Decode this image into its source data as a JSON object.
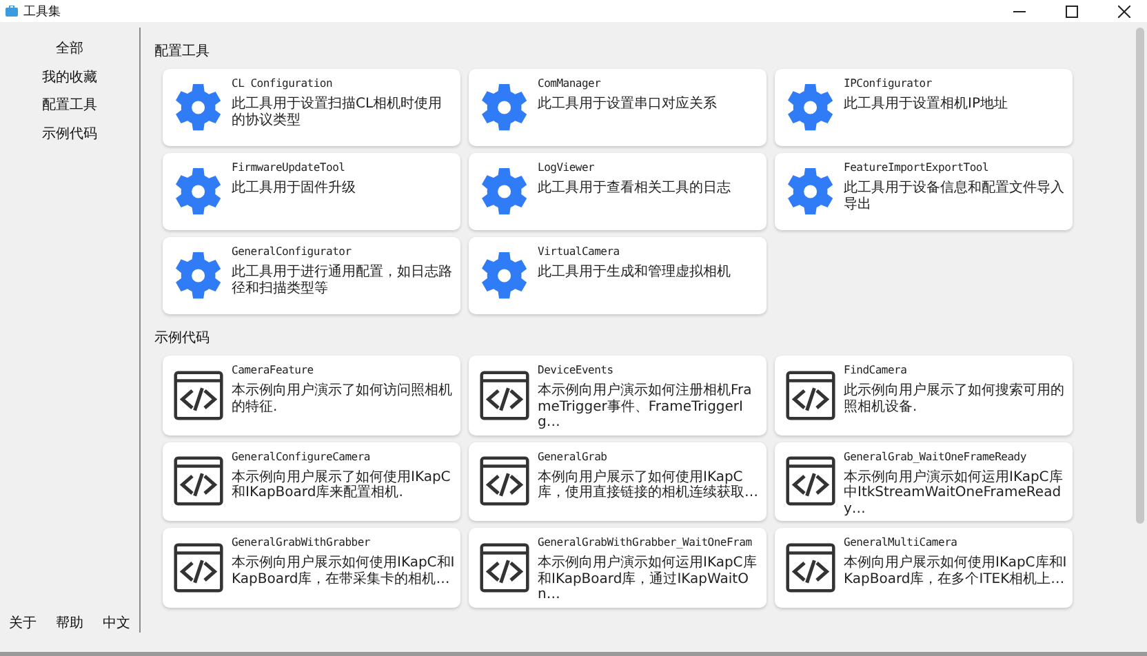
{
  "window": {
    "title": "工具集"
  },
  "sidebar": {
    "items": [
      {
        "label": "全部",
        "selected": false
      },
      {
        "label": "我的收藏",
        "selected": false
      },
      {
        "label": "配置工具",
        "selected": false
      },
      {
        "label": "示例代码",
        "selected": false
      }
    ],
    "footer": [
      "关于",
      "帮助",
      "中文"
    ]
  },
  "sections": [
    {
      "title": "配置工具",
      "kind": "tool",
      "cards": [
        {
          "name": "CL Configuration",
          "description": "此工具用于设置扫描CL相机时使用的协议类型"
        },
        {
          "name": "ComManager",
          "description": "此工具用于设置串口对应关系"
        },
        {
          "name": "IPConfigurator",
          "description": "此工具用于设置相机IP地址"
        },
        {
          "name": "FirmwareUpdateTool",
          "description": "此工具用于固件升级"
        },
        {
          "name": "LogViewer",
          "description": "此工具用于查看相关工具的日志"
        },
        {
          "name": "FeatureImportExportTool",
          "description": "此工具用于设备信息和配置文件导入导出"
        },
        {
          "name": "GeneralConfigurator",
          "description": "此工具用于进行通用配置，如日志路径和扫描类型等"
        },
        {
          "name": "VirtualCamera",
          "description": "此工具用于生成和管理虚拟相机"
        }
      ]
    },
    {
      "title": "示例代码",
      "kind": "code",
      "cards": [
        {
          "name": "CameraFeature",
          "description": "本示例向用户演示了如何访问照相机的特征."
        },
        {
          "name": "DeviceEvents",
          "description": "本示例向用户演示如何注册相机FrameTrigger事件、FrameTriggerIg…"
        },
        {
          "name": "FindCamera",
          "description": "此示例向用户展示了如何搜索可用的照相机设备."
        },
        {
          "name": "GeneralConfigureCamera",
          "description": "本示例向用户展示了如何使用IKapC和IKapBoard库来配置相机."
        },
        {
          "name": "GeneralGrab",
          "description": "本例向用户展示了如何使用IKapC库，使用直接链接的相机连续获取…"
        },
        {
          "name": "GeneralGrab_WaitOneFrameReady",
          "description": "本示例向用户演示如何运用IKapC库中ItkStreamWaitOneFrameReady…"
        },
        {
          "name": "GeneralGrabWithGrabber",
          "description": "本示例向用户展示如何使用IKapC和IKapBoard库，在带采集卡的相机…"
        },
        {
          "name": "GeneralGrabWithGrabber_WaitOneFram",
          "description": "本示例向用户演示如何运用IKapC库和IKapBoard库，通过IKapWaitOn…"
        },
        {
          "name": "GeneralMultiCamera",
          "description": "本例向用户展示如何使用IKapC库和IKapBoard库，在多个ITEK相机上…"
        }
      ]
    }
  ]
}
